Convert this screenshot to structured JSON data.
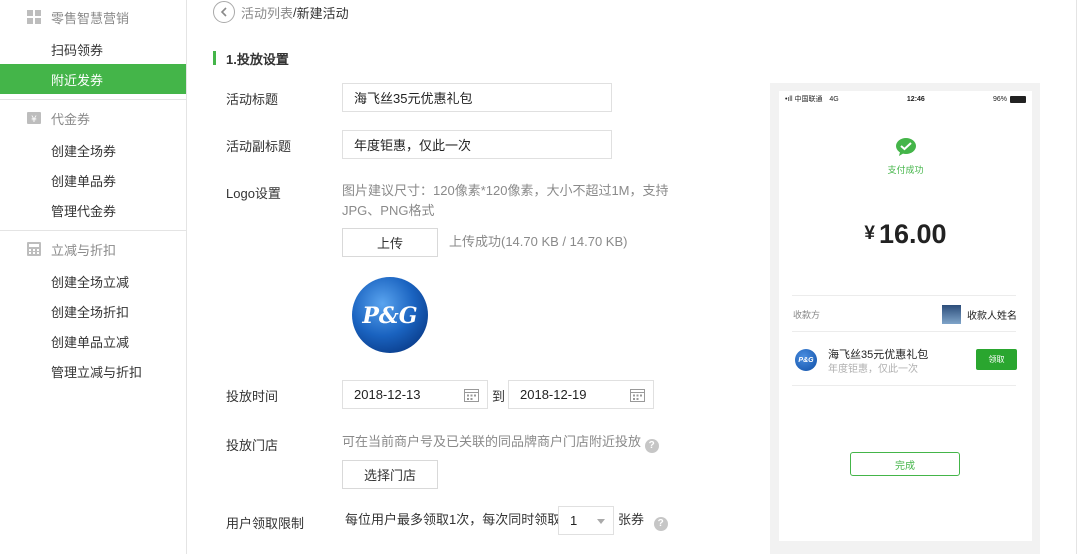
{
  "sidebar": {
    "groups": [
      {
        "title": "零售智慧营销",
        "icon": "grid-icon",
        "items": [
          {
            "label": "扫码领券"
          },
          {
            "label": "附近发券",
            "active": true
          }
        ]
      },
      {
        "title": "代金券",
        "icon": "yen-icon",
        "items": [
          {
            "label": "创建全场券"
          },
          {
            "label": "创建单品券"
          },
          {
            "label": "管理代金券"
          }
        ]
      },
      {
        "title": "立减与折扣",
        "icon": "calculator-icon",
        "items": [
          {
            "label": "创建全场立减"
          },
          {
            "label": "创建全场折扣"
          },
          {
            "label": "创建单品立减"
          },
          {
            "label": "管理立减与折扣"
          }
        ]
      }
    ]
  },
  "breadcrumb": {
    "parent": "活动列表",
    "separator": "/",
    "current": "新建活动"
  },
  "section": {
    "title": "1.投放设置"
  },
  "form": {
    "title_label": "活动标题",
    "title_value": "海飞丝35元优惠礼包",
    "subtitle_label": "活动副标题",
    "subtitle_value": "年度钜惠，仅此一次",
    "logo_label": "Logo设置",
    "logo_hint_line1": "图片建议尺寸：120像素*120像素，大小不超过1M，支持",
    "logo_hint_line2": "JPG、PNG格式",
    "upload_button": "上传",
    "upload_status": "上传成功(14.70 KB / 14.70 KB)",
    "logo_text": "P&G",
    "time_label": "投放时间",
    "start_date": "2018-12-13",
    "to_text": "到",
    "end_date": "2018-12-19",
    "store_label": "投放门店",
    "store_hint": "可在当前商户号及已关联的同品牌商户门店附近投放",
    "store_button": "选择门店",
    "limit_label": "用户领取限制",
    "limit_prefix": "每位用户最多领取1次，每次同时领取",
    "limit_value": "1",
    "limit_suffix": "张券"
  },
  "preview": {
    "carrier": "•ıll 中国联通",
    "network": "4G",
    "time": "12:46",
    "battery": "96%",
    "pay_success": "支付成功",
    "currency": "¥",
    "amount": "16.00",
    "payee_label": "收款方",
    "payee_name": "收款人姓名",
    "coupon_title": "海飞丝35元优惠礼包",
    "coupon_subtitle": "年度钜惠，仅此一次",
    "claim_button": "领取",
    "done_button": "完成"
  },
  "colors": {
    "accent": "#44b549",
    "claim": "#2aa62f",
    "pg_blue": "#0e4ea6"
  }
}
